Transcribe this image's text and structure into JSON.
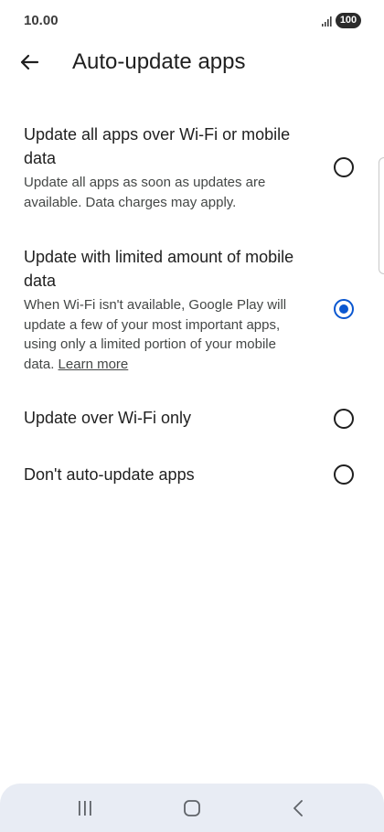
{
  "status": {
    "time": "10.00",
    "battery": "100"
  },
  "header": {
    "title": "Auto-update apps",
    "back_icon": "arrow-left-icon"
  },
  "options": [
    {
      "title": "Update all apps over Wi-Fi or mobile data",
      "description": "Update all apps as soon as updates are available. Data charges may apply.",
      "selected": false
    },
    {
      "title": "Update with limited amount of mobile data",
      "description": "When Wi-Fi isn't available, Google Play will update a few of your most important apps, using only a limited portion of your mobile data.",
      "link": "Learn more",
      "selected": true
    },
    {
      "title": "Update over Wi-Fi only",
      "selected": false
    },
    {
      "title": "Don't auto-update apps",
      "selected": false
    }
  ],
  "nav": {
    "icons": [
      "recents-icon",
      "home-icon",
      "back-icon"
    ]
  },
  "colors": {
    "accent": "#0b57d0",
    "nav_bg": "#e8ecf4"
  }
}
